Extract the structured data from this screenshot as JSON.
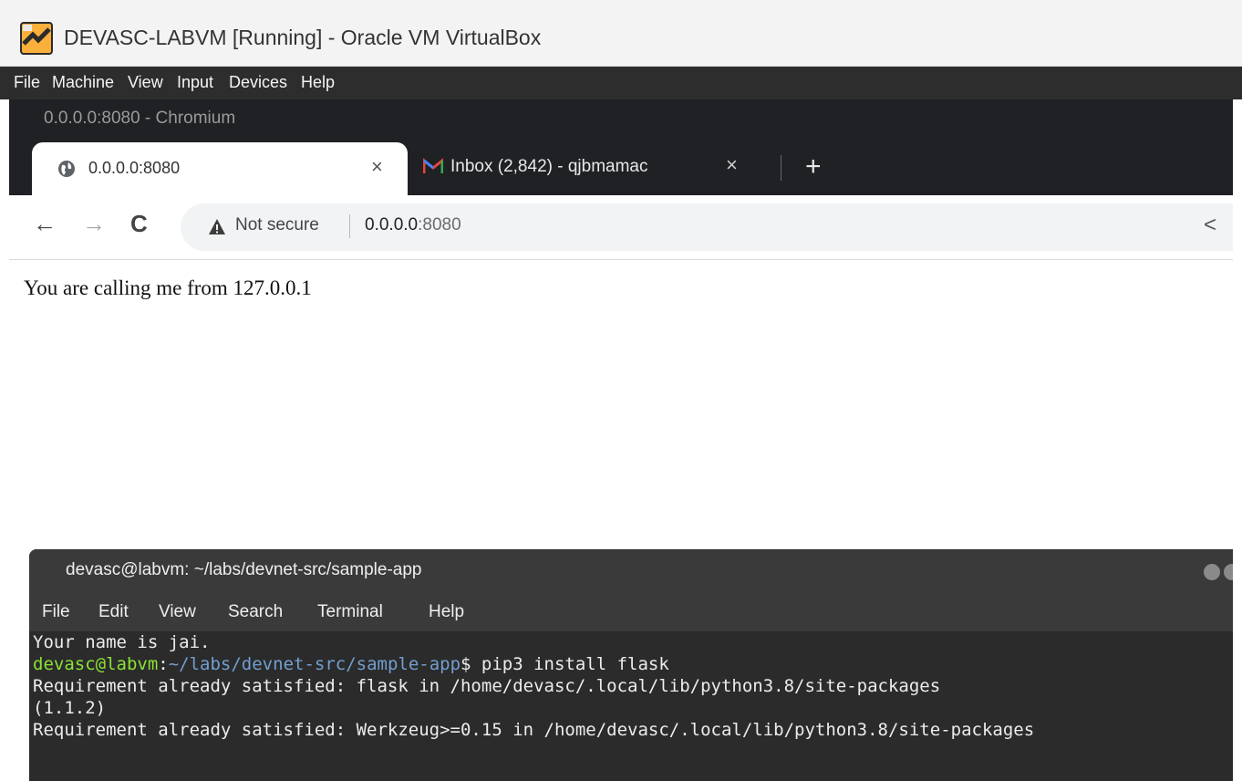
{
  "vbox": {
    "title": "DEVASC-LABVM [Running] - Oracle VM VirtualBox",
    "menu": [
      "File",
      "Machine",
      "View",
      "Input",
      "Devices",
      "Help"
    ]
  },
  "chromium": {
    "window_title": "0.0.0.0:8080 - Chromium",
    "tabs": [
      {
        "label": "0.0.0.0:8080",
        "close": "×",
        "icon": "globe-icon"
      },
      {
        "label": "Inbox (2,842) - qjbmamac",
        "close": "×",
        "icon": "gmail-icon"
      }
    ],
    "new_tab": "+",
    "nav": {
      "back": "←",
      "forward": "→",
      "reload": "C"
    },
    "omnibox": {
      "security": "Not secure",
      "url_host": "0.0.0.0",
      "url_port": ":8080"
    },
    "share": "<"
  },
  "page": {
    "text": "You are calling me from 127.0.0.1"
  },
  "terminal": {
    "title": "devasc@labvm: ~/labs/devnet-src/sample-app",
    "menu": [
      "File",
      "Edit",
      "View",
      "Search",
      "Terminal",
      "Help"
    ],
    "lines": {
      "l1": "Your name is jai.",
      "l2_user": "devasc@labvm",
      "l2_colon": ":",
      "l2_path": "~/labs/devnet-src/sample-app",
      "l2_cmd": "$ pip3 install flask",
      "l3": "Requirement already satisfied: flask in /home/devasc/.local/lib/python3.8/site-packages",
      "l4": "(1.1.2)",
      "l5": "Requirement already satisfied: Werkzeug>=0.15 in /home/devasc/.local/lib/python3.8/site-packages"
    }
  },
  "colors": {
    "terminal_user": "#8ae234",
    "terminal_path": "#729fcf",
    "chromium_frame": "#1f2124"
  }
}
